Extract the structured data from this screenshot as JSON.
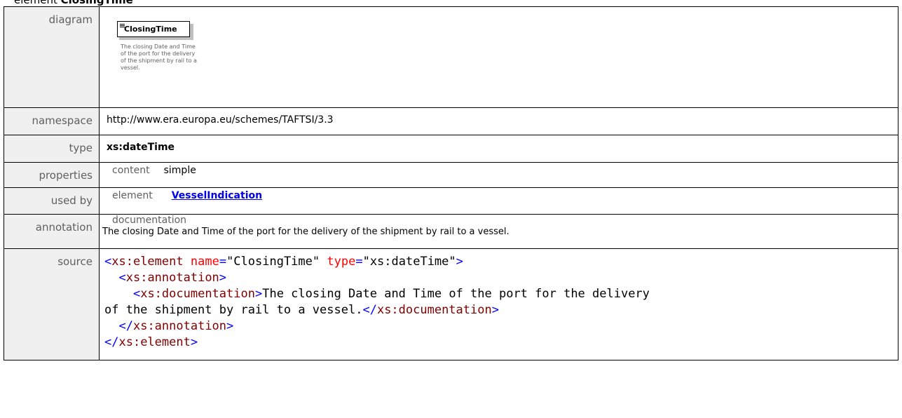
{
  "heading": {
    "prefix": "element ",
    "name": "ClosingTime"
  },
  "rows": {
    "diagram": {
      "label": "diagram",
      "box_name": "ClosingTime",
      "doc_lines": [
        "The closing Date and Time",
        "of the port for the delivery",
        "of the shipment by rail to a",
        "vessel."
      ]
    },
    "namespace": {
      "label": "namespace",
      "value": "http://www.era.europa.eu/schemes/TAFTSI/3.3"
    },
    "type": {
      "label": "type",
      "value": "xs:dateTime"
    },
    "properties": {
      "label": "properties",
      "key": "content",
      "value": "simple"
    },
    "usedby": {
      "label": "used by",
      "key": "element",
      "link": "VesselIndication"
    },
    "annotation": {
      "label": "annotation",
      "key": "documentation",
      "text": "The closing Date and Time of the port for the delivery of the shipment by rail to a vessel."
    },
    "source": {
      "label": "source",
      "lines": [
        [
          {
            "t": "<",
            "c": "b"
          },
          {
            "t": "xs:element",
            "c": "el"
          },
          {
            "t": " "
          },
          {
            "t": "name",
            "c": "at"
          },
          {
            "t": "=",
            "c": "eq"
          },
          {
            "t": "\"ClosingTime\"",
            "c": "str"
          },
          {
            "t": " "
          },
          {
            "t": "type",
            "c": "at"
          },
          {
            "t": "=",
            "c": "eq"
          },
          {
            "t": "\"xs:dateTime\"",
            "c": "str"
          },
          {
            "t": ">",
            "c": "b"
          }
        ],
        [
          {
            "t": "  "
          },
          {
            "t": "<",
            "c": "b"
          },
          {
            "t": "xs:annotation",
            "c": "el"
          },
          {
            "t": ">",
            "c": "b"
          }
        ],
        [
          {
            "t": "    "
          },
          {
            "t": "<",
            "c": "b"
          },
          {
            "t": "xs:documentation",
            "c": "el"
          },
          {
            "t": ">",
            "c": "b"
          },
          {
            "t": "The closing Date and Time of the port for the delivery",
            "c": "txt"
          }
        ],
        [
          {
            "t": "of the shipment by rail to a vessel.",
            "c": "txt"
          },
          {
            "t": "</",
            "c": "b"
          },
          {
            "t": "xs:documentation",
            "c": "el"
          },
          {
            "t": ">",
            "c": "b"
          }
        ],
        [
          {
            "t": "  "
          },
          {
            "t": "</",
            "c": "b"
          },
          {
            "t": "xs:annotation",
            "c": "el"
          },
          {
            "t": ">",
            "c": "b"
          }
        ],
        [
          {
            "t": "</",
            "c": "b"
          },
          {
            "t": "xs:element",
            "c": "el"
          },
          {
            "t": ">",
            "c": "b"
          }
        ]
      ]
    }
  },
  "colors": {
    "label_bg": "#f0f0f0",
    "label_text": "#606060",
    "link": "#0000ee",
    "xml_bracket": "#0000ff",
    "xml_element": "#800000",
    "xml_attribute": "#ff0000"
  }
}
